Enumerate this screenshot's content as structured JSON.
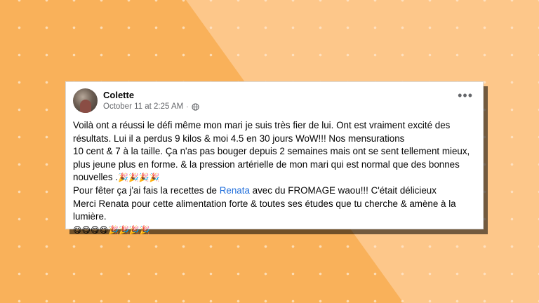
{
  "post": {
    "author": "Colette",
    "timestamp": "October 11 at 2:25 AM",
    "separator": "·",
    "audience_icon": "globe-icon",
    "more_label": "•••",
    "lines": [
      "Voilà ont a réussi le défi même mon mari je suis très fier de lui. Ont est vraiment excité des",
      "résultats. Lui il a perdus 9 kilos & moi 4.5 en 30 jours WoW!!! Nos mensurations",
      "10 cent & 7 à la taille. Ça n'as pas bouger depuis 2 semaines mais ont se sent tellement mieux,",
      "plus jeune plus en forme. & la pression artérielle de mon mari qui est normal que des bonnes",
      "nouvelles ."
    ],
    "emoji_line_1": "🎉🎉🎉🎉",
    "recipe_line_before": "Pour fêter ça j'ai fais la recettes de ",
    "mention": "Renata",
    "recipe_line_after": " avec du FROMAGE waou!!! C'était délicieux",
    "thanks_line_1": "Merci Renata pour cette alimentation forte & toutes ses études que tu cherche & amène à la",
    "thanks_line_2": "lumière.",
    "emoji_line_2": "😋😋😋😋🎉🎉🎉🎉"
  },
  "colors": {
    "background_dark": "#f9b15a",
    "background_light": "#fdc78a",
    "card": "#ffffff",
    "text": "#050505",
    "meta_text": "#65676b",
    "mention": "#216fdb"
  }
}
